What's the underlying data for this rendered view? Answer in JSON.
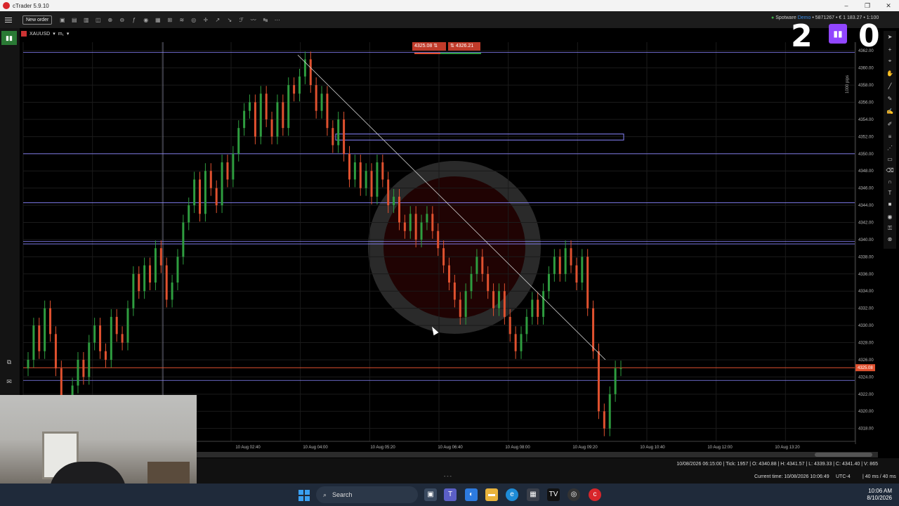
{
  "window": {
    "title": "cTrader 5.9.10",
    "minimize": "–",
    "maximize": "❐",
    "close": "✕"
  },
  "toolbar": {
    "new_order": "New order",
    "account": "Spotware",
    "account_mode": "Demo",
    "account_info": "• 5871267 • € 1 183.27 • 1:100"
  },
  "chart_tab": {
    "symbol": "XAUUSD",
    "timeframe": "m₁"
  },
  "price_chips": {
    "sell": "4325.08",
    "buy": "4326.21",
    "sell_icon": "sell-arrow",
    "buy_icon": "buy-arrow"
  },
  "overlay": {
    "left_num": "2",
    "right_num": "0",
    "icon": "twitch-icon"
  },
  "vertical_label": "1000 pips",
  "colors": {
    "bull": "#2e9d3f",
    "bear": "#e0512f",
    "hline": "#8a86ff",
    "orange_line": "#e0512f",
    "grid": "#1b1b1b"
  },
  "chart_data": {
    "type": "candlestick",
    "symbol": "XAUUSD",
    "y_ticks": [
      "4362.00",
      "4360.00",
      "4358.00",
      "4356.00",
      "4354.00",
      "4352.00",
      "4350.00",
      "4348.00",
      "4346.00",
      "4344.00",
      "4342.00",
      "4340.00",
      "4338.00",
      "4336.00",
      "4334.00",
      "4332.00",
      "4330.00",
      "4328.00",
      "4326.00",
      "4324.00",
      "4322.00",
      "4320.00",
      "4318.00"
    ],
    "x_ticks": [
      "10 Aug 02:40",
      "10 Aug 04:00",
      "10 Aug 05:20",
      "10 Aug 06:40",
      "10 Aug 08:00",
      "10 Aug 09:20",
      "10 Aug 10:40",
      "10 Aug 12:00",
      "10 Aug 13:20"
    ],
    "ylim": [
      4316.5,
      4363
    ],
    "current_price": "4325.08",
    "horizontal_levels": [
      4361.8,
      4350.0,
      4344.3,
      4339.8,
      4339.5,
      4323.6
    ],
    "current_level": 4325.08,
    "rectangle": {
      "price_top": 4352.3,
      "price_bottom": 4351.6,
      "start_label": "10 Aug 04:25",
      "end_label": "10 Aug 09:00"
    },
    "trendline": [
      [
        4361.5,
        4326.0
      ]
    ],
    "close_prices": [
      4326,
      4330,
      4327,
      4332,
      4329,
      4325,
      4321,
      4318,
      4323,
      4326,
      4324,
      4328,
      4330,
      4327,
      4326,
      4331,
      4329,
      4328,
      4332,
      4336,
      4334,
      4337,
      4335,
      4339,
      4337,
      4333,
      4335,
      4338,
      4342,
      4344,
      4347,
      4343,
      4348,
      4346,
      4344,
      4349,
      4347,
      4350,
      4353,
      4355,
      4356,
      4352,
      4357,
      4354,
      4352,
      4356,
      4353,
      4358,
      4357,
      4359,
      4361,
      4358,
      4355,
      4357,
      4353,
      4351,
      4354,
      4350,
      4347,
      4349,
      4346,
      4348,
      4345,
      4349,
      4347,
      4344,
      4345,
      4342,
      4341,
      4343,
      4340,
      4342,
      4343,
      4341,
      4339,
      4337,
      4335,
      4333,
      4331,
      4334,
      4336,
      4338,
      4336,
      4334,
      4332,
      4334,
      4331,
      4329,
      4327,
      4329,
      4331,
      4333,
      4331,
      4334,
      4336,
      4338,
      4336,
      4339,
      4337,
      4335,
      4338,
      4332,
      4327,
      4320,
      4318,
      4322,
      4325,
      4325
    ]
  },
  "status": {
    "ohlc": "10/08/2026 06:15:00 | Tick: 1957 | O: 4340.88 | H: 4341.57 | L: 4339.33 | C: 4341.40 | V: 865",
    "current_time": "Current time: 10/08/2026 10:06:49",
    "timezone": "UTC-4",
    "latency": "| 40 ms / 40 ms",
    "dots": "- - -"
  },
  "taskbar": {
    "search": "Search",
    "time": "10:06 AM",
    "date": "8/10/2026"
  }
}
